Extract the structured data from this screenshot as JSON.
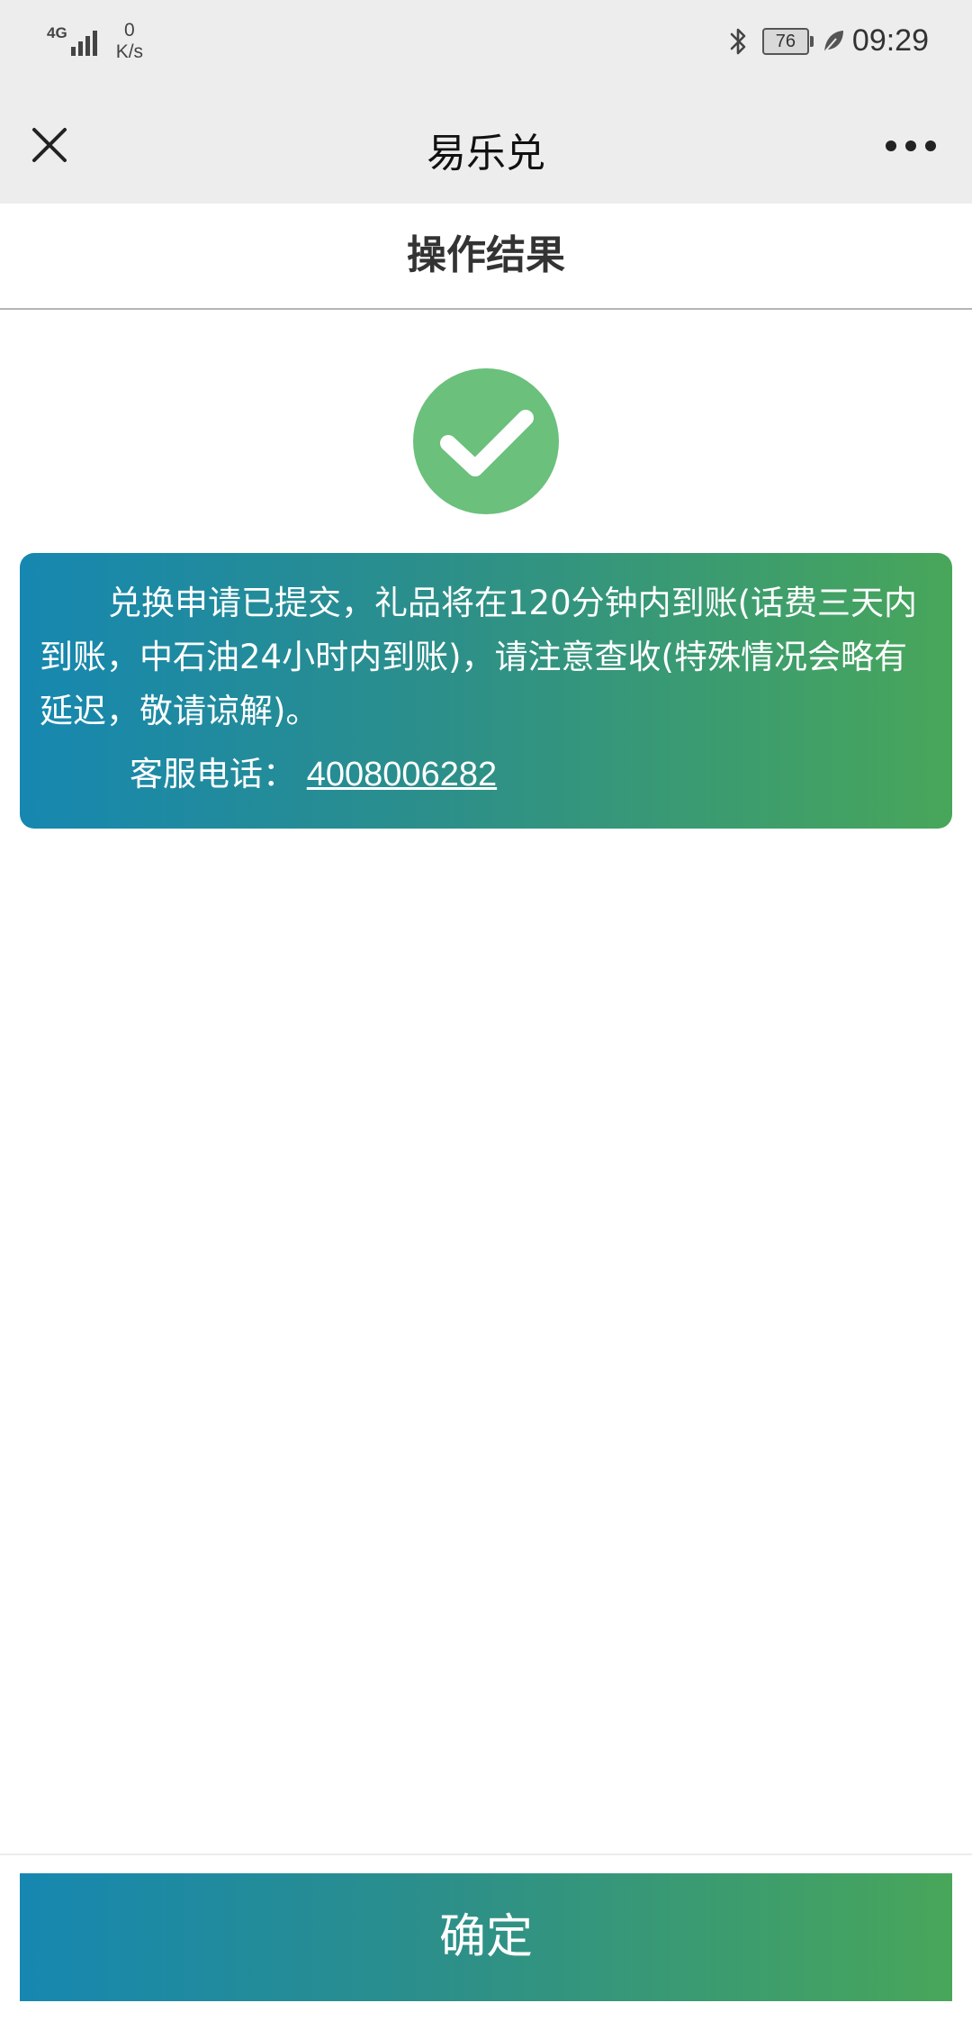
{
  "status_bar": {
    "network": "4G",
    "speed_value": "0",
    "speed_unit": "K/s",
    "battery": "76",
    "time": "09:29",
    "icons": [
      "signal-icon",
      "bluetooth-icon",
      "battery-icon",
      "leaf-icon"
    ]
  },
  "nav": {
    "title": "易乐兑",
    "close_icon": "close-icon",
    "more_icon": "more-icon"
  },
  "header": {
    "title": "操作结果"
  },
  "result": {
    "icon": "check-circle-icon",
    "icon_color": "#6bc07c",
    "message": "兑换申请已提交，礼品将在120分钟内到账(话费三天内到账，中石油24小时内到账)，请注意查收(特殊情况会略有延迟，敬请谅解)。",
    "phone_label": "客服电话：",
    "phone_number": "4008006282"
  },
  "footer": {
    "confirm_label": "确定"
  },
  "colors": {
    "gradient_start": "#1687b0",
    "gradient_end": "#48a65a",
    "bar_background": "#ededed"
  }
}
